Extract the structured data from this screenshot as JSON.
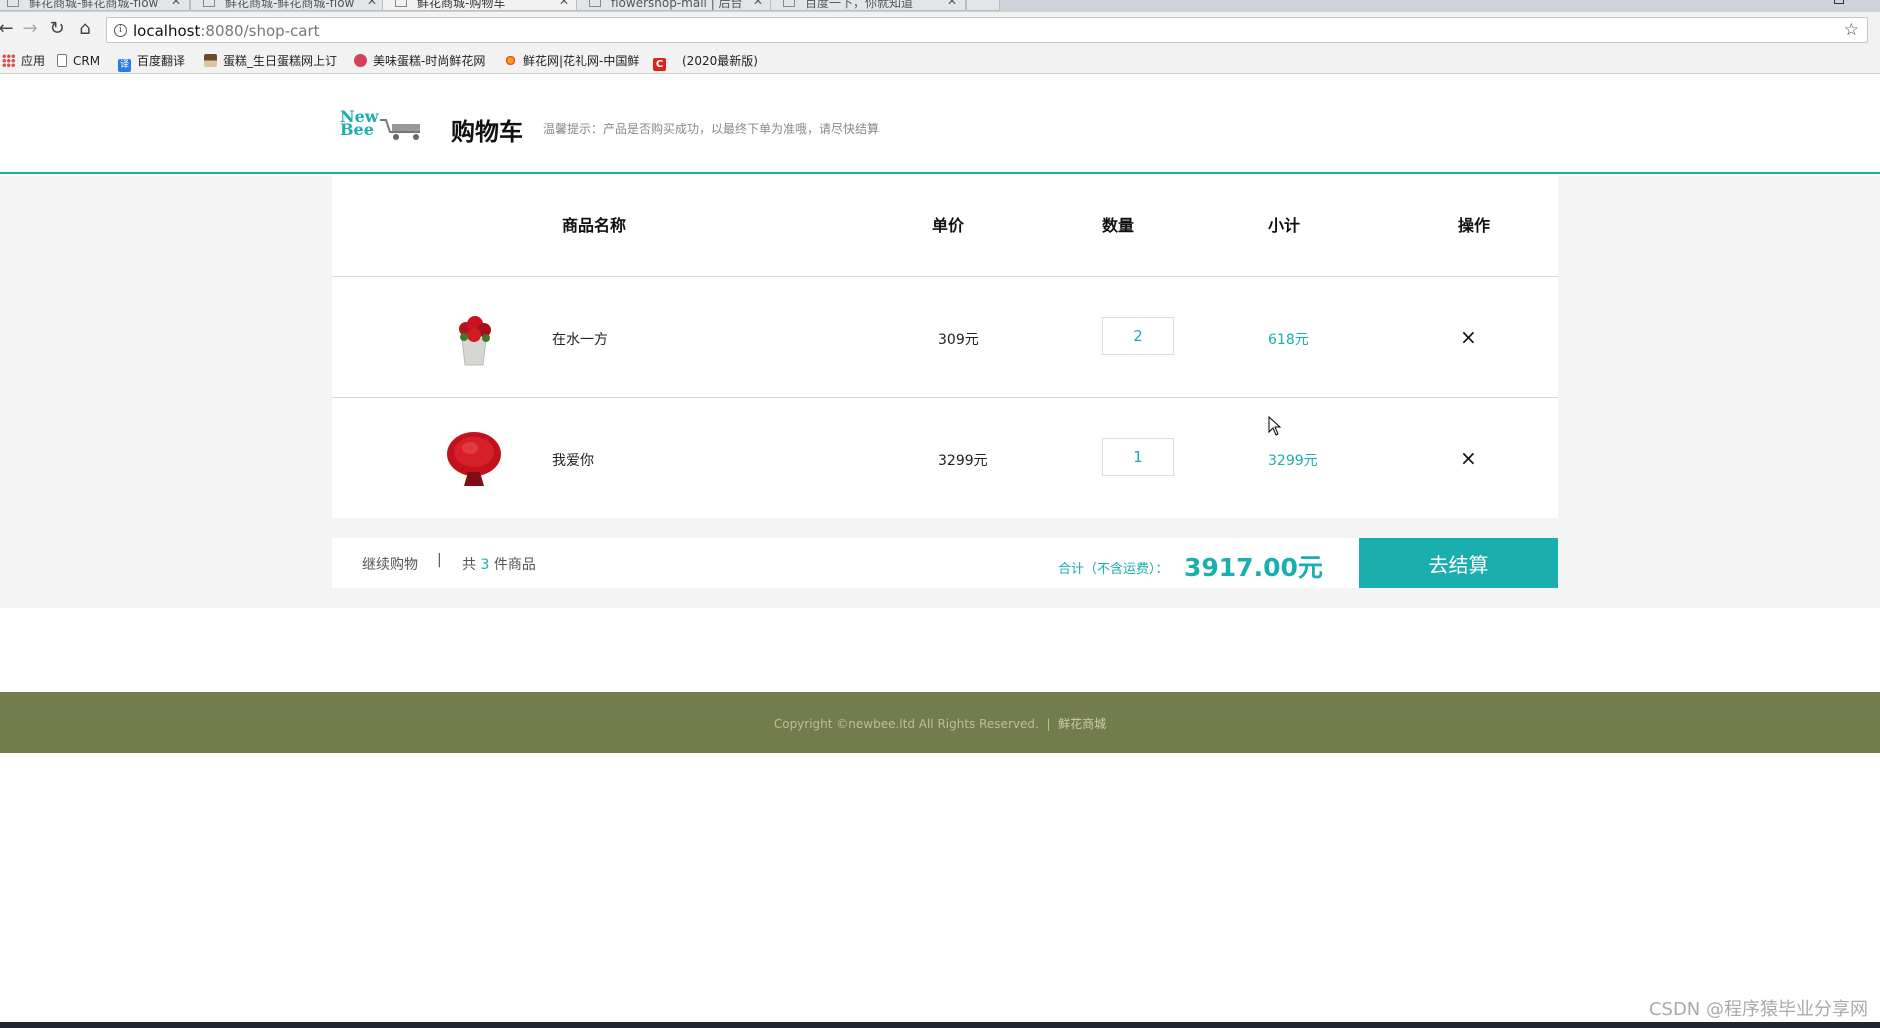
{
  "browser": {
    "tabs": [
      {
        "title": "鲜花商城-鲜花商城-flow"
      },
      {
        "title": "鲜花商城-鲜花商城-flow"
      },
      {
        "title": "鲜花商城-购物车"
      },
      {
        "title": "flowershop-mall | 后台"
      },
      {
        "title": "百度一下，你就知道"
      }
    ],
    "url_host": "localhost",
    "url_rest": ":8080/shop-cart",
    "bookmarks": [
      {
        "label": "应用",
        "icon": "apps-grid-icon"
      },
      {
        "label": "CRM",
        "icon": "page-icon"
      },
      {
        "label": "百度翻译",
        "icon": "translate-icon"
      },
      {
        "label": "蛋糕_生日蛋糕网上订",
        "icon": "cake-icon"
      },
      {
        "label": "美味蛋糕-时尚鲜花网",
        "icon": "flower-icon"
      },
      {
        "label": "鲜花网|花礼网-中国鲜",
        "icon": "flower-logo-icon"
      },
      {
        "label": "(2020最新版)",
        "icon": "csdn-icon"
      }
    ]
  },
  "header": {
    "logo_line1": "New",
    "logo_line2": "Bee",
    "title": "购物车",
    "tip": "温馨提示：产品是否购买成功，以最终下单为准哦，请尽快结算"
  },
  "cart": {
    "columns": {
      "name": "商品名称",
      "price": "单价",
      "qty": "数量",
      "subtotal": "小计",
      "action": "操作"
    },
    "items": [
      {
        "name": "在水一方",
        "price": "309元",
        "qty": "2",
        "subtotal": "618元",
        "remove": "×",
        "image": "rose-box-bouquet"
      },
      {
        "name": "我爱你",
        "price": "3299元",
        "qty": "1",
        "subtotal": "3299元",
        "remove": "×",
        "image": "red-rose-bouquet"
      }
    ],
    "footer": {
      "continue": "继续购物",
      "separator": "|",
      "count_prefix": "共",
      "count": "3",
      "count_suffix": "件商品",
      "total_label": "合计（不含运费）：",
      "total_value": "3917.00元",
      "checkout": "去结算"
    }
  },
  "footer": {
    "copyright": "Copyright ©newbee.ltd All Rights Reserved.",
    "separator": "|",
    "link": "鲜花商城"
  },
  "watermark": "CSDN @程序猿毕业分享网",
  "colors": {
    "accent": "#1baeae",
    "footer_bg": "#737c4d"
  }
}
